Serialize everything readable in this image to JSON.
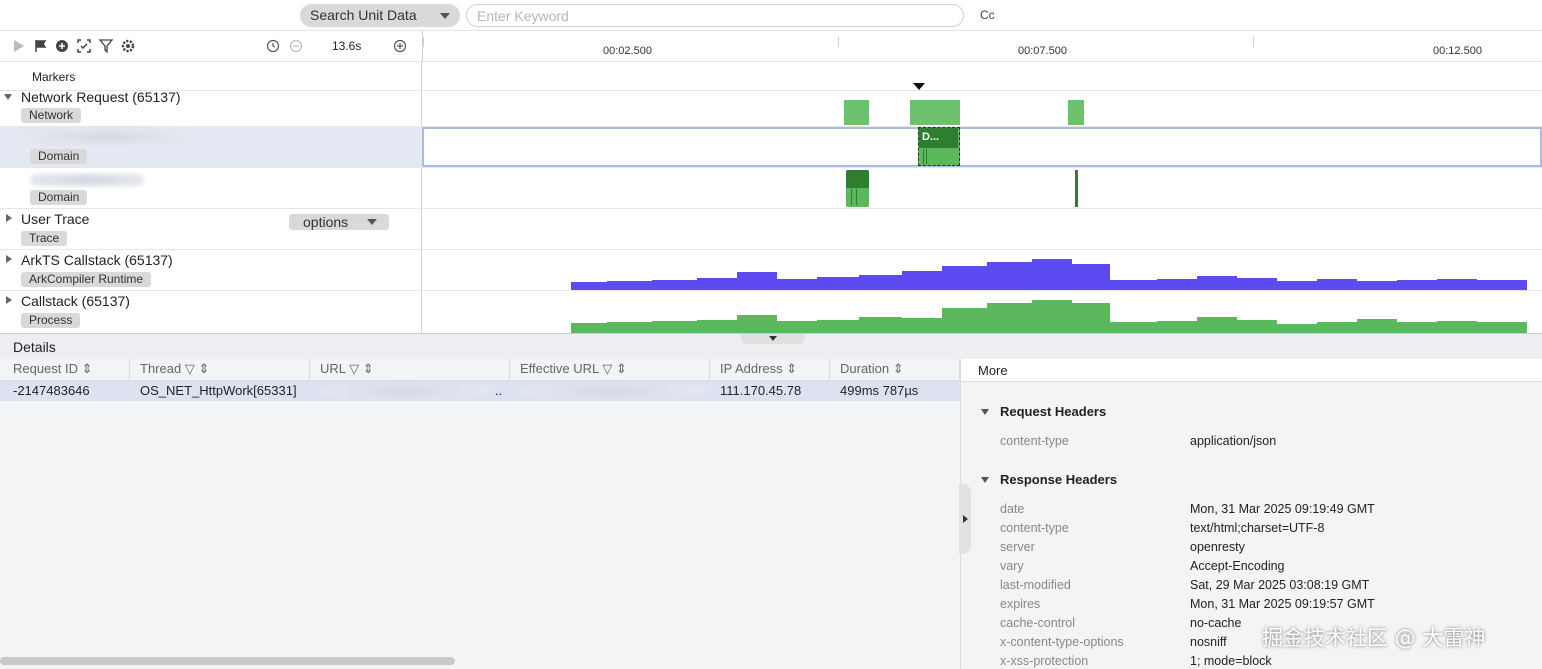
{
  "search": {
    "type_label": "Search Unit Data",
    "placeholder": "Enter Keyword",
    "case_toggle": "Cc"
  },
  "toolbar": {
    "icons": [
      "play-icon",
      "flag-icon",
      "marker-icon",
      "screenshot-icon",
      "filter-icon",
      "settings-icon",
      "reset-zoom-icon",
      "zoom-out-icon",
      "zoom-in-icon"
    ],
    "zoom_value": "13.6s"
  },
  "ruler": {
    "ticks": [
      "00:02.500",
      "00:07.500",
      "00:12.500"
    ]
  },
  "tracks": {
    "markers": {
      "title": "Markers"
    },
    "network": {
      "title": "Network Request (65137)",
      "badge": "Network"
    },
    "domain1": {
      "badge": "Domain",
      "box_label": "D..."
    },
    "domain2": {
      "badge": "Domain"
    },
    "user_trace": {
      "title": "User Trace",
      "badge": "Trace",
      "options_label": "options"
    },
    "arkts": {
      "title": "ArkTS Callstack (65137)",
      "badge": "ArkCompiler Runtime",
      "color": "#5b4bf0"
    },
    "callstack": {
      "title": "Callstack (65137)",
      "badge": "Process",
      "color": "#5cb85c"
    }
  },
  "details": {
    "title": "Details",
    "columns": [
      "Request ID",
      "Thread",
      "URL",
      "Effective URL",
      "IP Address",
      "Duration"
    ],
    "row": {
      "request_id": "-2147483646",
      "thread": "OS_NET_HttpWork[65331]",
      "url_suffix": "..",
      "ip": "111.170.45.78",
      "duration": "499ms 787µs"
    }
  },
  "more": {
    "title": "More",
    "request_headers_title": "Request Headers",
    "request_headers": [
      {
        "key": "content-type",
        "value": "application/json"
      }
    ],
    "response_headers_title": "Response Headers",
    "response_headers": [
      {
        "key": "date",
        "value": "Mon, 31 Mar 2025 09:19:49 GMT"
      },
      {
        "key": "content-type",
        "value": "text/html;charset=UTF-8"
      },
      {
        "key": "server",
        "value": "openresty"
      },
      {
        "key": "vary",
        "value": "Accept-Encoding"
      },
      {
        "key": "last-modified",
        "value": "Sat, 29 Mar 2025 03:08:19 GMT"
      },
      {
        "key": "expires",
        "value": "Mon, 31 Mar 2025 09:19:57 GMT"
      },
      {
        "key": "cache-control",
        "value": "no-cache"
      },
      {
        "key": "x-content-type-options",
        "value": "nosniff"
      },
      {
        "key": "x-xss-protection",
        "value": "1; mode=block"
      }
    ]
  },
  "watermark": "掘金技术社区 @ 大雷神"
}
